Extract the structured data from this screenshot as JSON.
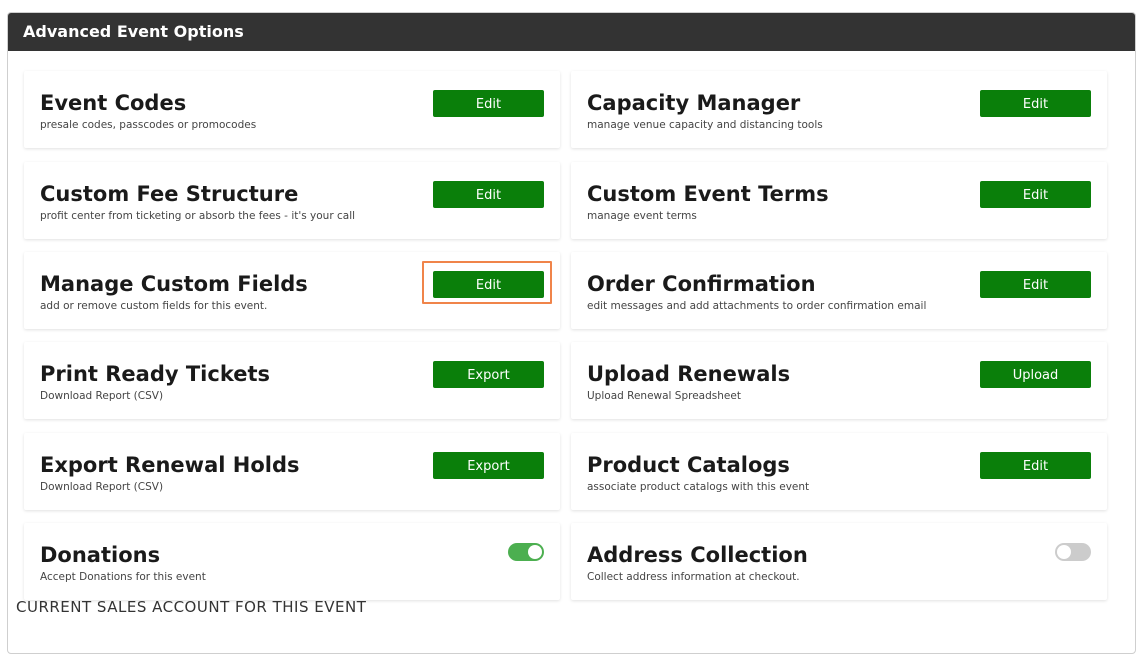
{
  "panel": {
    "title": "Advanced Event Options",
    "footer_text": "CURRENT SALES ACCOUNT FOR THIS EVENT"
  },
  "cards": {
    "event_codes": {
      "title": "Event Codes",
      "subtitle": "presale codes, passcodes or promocodes",
      "button": "Edit"
    },
    "capacity_manager": {
      "title": "Capacity Manager",
      "subtitle": "manage venue capacity and distancing tools",
      "button": "Edit"
    },
    "custom_fee_structure": {
      "title": "Custom Fee Structure",
      "subtitle": "profit center from ticketing or absorb the fees - it's your call",
      "button": "Edit"
    },
    "custom_event_terms": {
      "title": "Custom Event Terms",
      "subtitle": "manage event terms",
      "button": "Edit"
    },
    "manage_custom_fields": {
      "title": "Manage Custom Fields",
      "subtitle": "add or remove custom fields for this event.",
      "button": "Edit"
    },
    "order_confirmation": {
      "title": "Order Confirmation",
      "subtitle": "edit messages and add attachments to order confirmation email",
      "button": "Edit"
    },
    "print_ready_tickets": {
      "title": "Print Ready Tickets",
      "subtitle": "Download Report (CSV)",
      "button": "Export"
    },
    "upload_renewals": {
      "title": "Upload Renewals",
      "subtitle": "Upload Renewal Spreadsheet",
      "button": "Upload"
    },
    "export_renewal_holds": {
      "title": "Export Renewal Holds",
      "subtitle": "Download Report (CSV)",
      "button": "Export"
    },
    "product_catalogs": {
      "title": "Product Catalogs",
      "subtitle": "associate product catalogs with this event",
      "button": "Edit"
    },
    "donations": {
      "title": "Donations",
      "subtitle": "Accept Donations for this event",
      "enabled": true
    },
    "address_collection": {
      "title": "Address Collection",
      "subtitle": "Collect address information at checkout.",
      "enabled": false
    }
  },
  "colors": {
    "header_bg": "#333333",
    "button_green": "#0a7f0a",
    "toggle_on": "#4caf50",
    "toggle_off": "#cccccc",
    "highlight_orange": "#f0844a"
  }
}
